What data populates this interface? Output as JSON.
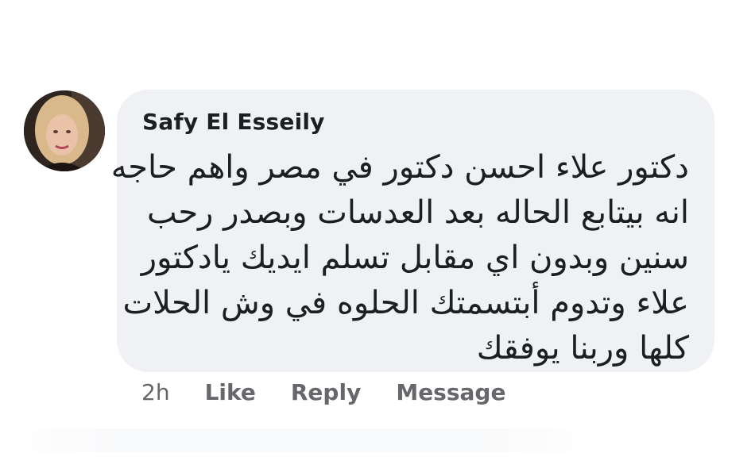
{
  "comment": {
    "author": "Safy El Esseily",
    "avatar_icon": "profile-photo-avatar",
    "text_lines": [
      "دكتور علاء احسن دكتور في مصر واهم حاجه",
      "انه بيتابع الحاله بعد العدسات وبصدر رحب",
      "سنين وبدون اي مقابل تسلم ايديك يادكتور",
      "علاء وتدوم أبتسمتك الحلوه في وش الحلات",
      "كلها وربنا يوفقك"
    ],
    "timestamp": "2h",
    "actions": {
      "like": "Like",
      "reply": "Reply",
      "message": "Message"
    }
  },
  "colors": {
    "bubble_bg": "#f0f1f4",
    "text": "#1c1e21",
    "secondary_text": "#65676b"
  }
}
